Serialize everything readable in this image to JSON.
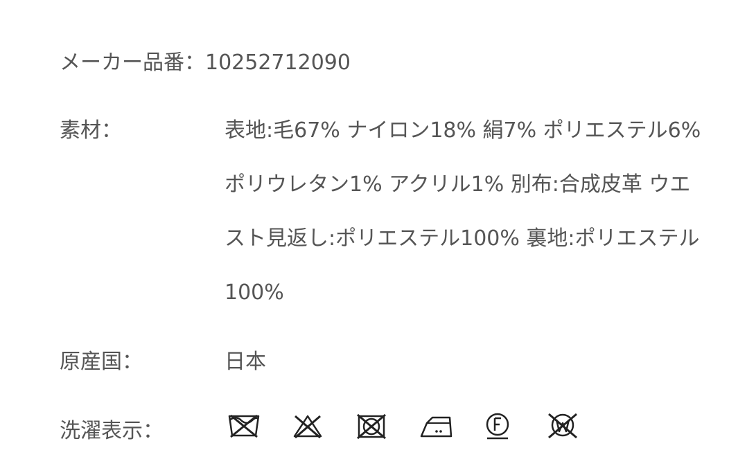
{
  "product_details": {
    "maker_part": {
      "label": "メーカー品番：",
      "value": "10252712090"
    },
    "material": {
      "label": "素材：",
      "value": "表地:毛67% ナイロン18% 絹7% ポリエステル6% ポリウレタン1% アクリル1% 別布:合成皮革 ウエスト見返し:ポリエステル100% 裏地:ポリエステル100%"
    },
    "origin": {
      "label": "原産国：",
      "value": "日本"
    },
    "washing": {
      "label": "洗濯表示："
    }
  },
  "care_symbols": [
    {
      "name": "washtub-crossed-icon"
    },
    {
      "name": "bleach-prohibited-icon"
    },
    {
      "name": "tumble-dry-prohibited-icon"
    },
    {
      "name": "iron-medium-icon"
    },
    {
      "name": "dry-clean-f-icon"
    },
    {
      "name": "wet-clean-prohibited-icon"
    }
  ],
  "colors": {
    "text": "#555555",
    "icon_stroke": "#222222"
  }
}
